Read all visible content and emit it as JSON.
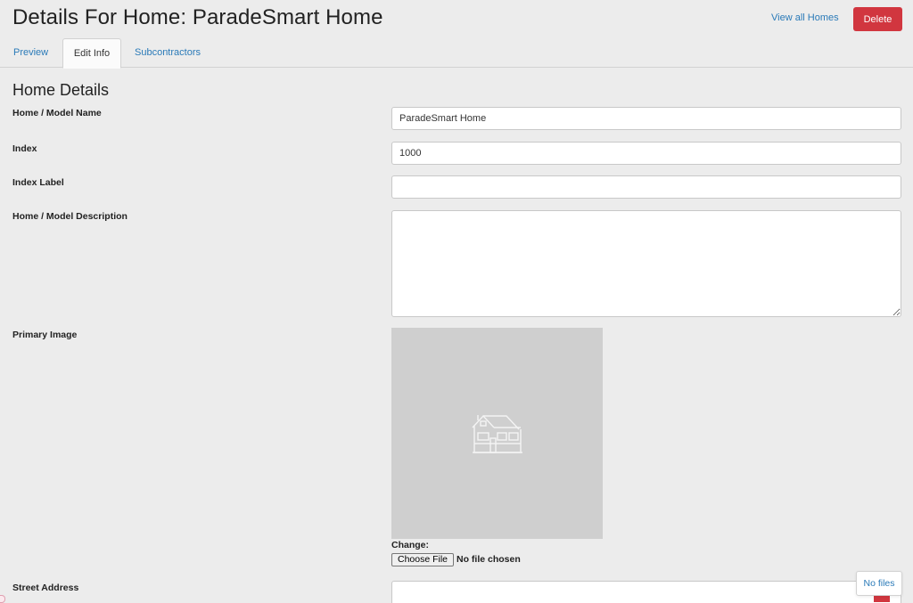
{
  "header": {
    "title": "Details For Home: ParadeSmart Home",
    "view_all_link": "View all Homes",
    "delete_button": "Delete"
  },
  "tabs": [
    {
      "label": "Preview",
      "active": false
    },
    {
      "label": "Edit Info",
      "active": true
    },
    {
      "label": "Subcontractors",
      "active": false
    }
  ],
  "section": {
    "title": "Home Details"
  },
  "fields": {
    "model_name": {
      "label": "Home / Model Name",
      "value": "ParadeSmart Home"
    },
    "index": {
      "label": "Index",
      "value": "1000"
    },
    "index_label": {
      "label": "Index Label",
      "value": ""
    },
    "description": {
      "label": "Home / Model Description",
      "value": ""
    },
    "primary_image": {
      "label": "Primary Image",
      "placeholder_icon": "house-icon",
      "change_label": "Change:",
      "file_button": "Choose File",
      "file_status": "No file chosen"
    },
    "street_address": {
      "label": "Street Address",
      "value": ""
    }
  },
  "floating": {
    "no_files": "No files"
  },
  "colors": {
    "link": "#2a7ab8",
    "danger": "#d1363f",
    "background": "#ececec",
    "placeholder": "#cfcfcf"
  }
}
